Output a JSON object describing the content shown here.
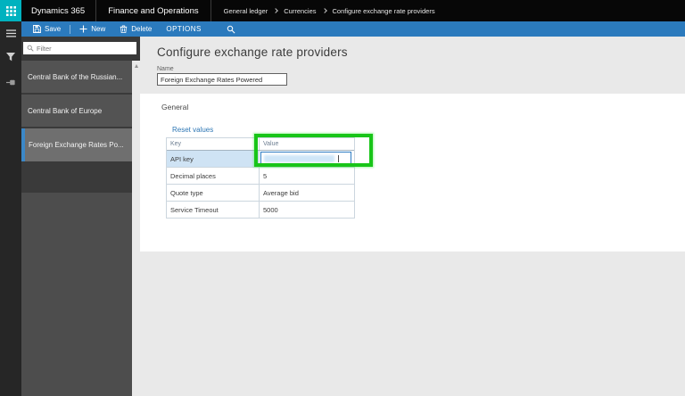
{
  "topbar": {
    "brand": "Dynamics 365",
    "product": "Finance and Operations",
    "breadcrumb": [
      "General ledger",
      "Currencies",
      "Configure exchange rate providers"
    ]
  },
  "command_bar": {
    "save": "Save",
    "new": "New",
    "delete": "Delete",
    "options": "OPTIONS"
  },
  "sidebar": {
    "filter_placeholder": "Filter",
    "items": [
      {
        "label": "Central Bank of the Russian...",
        "selected": false
      },
      {
        "label": "Central Bank of Europe",
        "selected": false
      },
      {
        "label": "Foreign Exchange Rates Po...",
        "selected": true
      }
    ]
  },
  "main": {
    "title": "Configure exchange rate providers",
    "name_label": "Name",
    "name_value": "Foreign Exchange Rates Powered",
    "section": {
      "header": "General",
      "reset_link": "Reset values",
      "table": {
        "columns": [
          "Key",
          "Value"
        ],
        "rows": [
          {
            "key": "API key",
            "value": "",
            "redacted": true,
            "selected": true
          },
          {
            "key": "Decimal places",
            "value": "5"
          },
          {
            "key": "Quote type",
            "value": "Average bid"
          },
          {
            "key": "Service Timeout",
            "value": "5000"
          }
        ]
      }
    }
  },
  "icons": {
    "waffle": "app-launcher grid",
    "menu": "hamburger",
    "filter": "funnel",
    "pin": "pin",
    "save": "floppy-disk",
    "new": "plus",
    "delete": "trash-can",
    "search": "magnifier",
    "scroll_up": "triangle-up",
    "breadcrumb_separator": "chevron-right"
  },
  "colors": {
    "topbar_bg": "#070707",
    "command_bar_blue": "#2b7abd",
    "app_launcher_teal": "#00b2bf",
    "sidebar_bg": "#4d4d4d",
    "selected_item_bg": "#6f6f6f",
    "selected_item_accent": "#3b88c8",
    "row_highlight_blue": "#cfe3f4",
    "annotation_green": "#18c518",
    "link_blue": "#2e77b5"
  }
}
